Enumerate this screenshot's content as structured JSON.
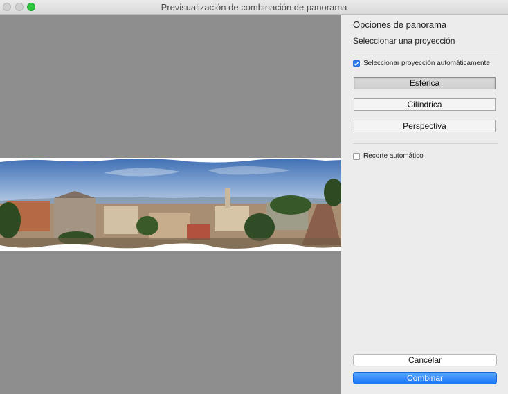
{
  "window": {
    "title": "Previsualización de combinación de panorama"
  },
  "panorama_options": {
    "heading": "Opciones de panorama",
    "subheading": "Seleccionar una proyección",
    "auto_select": {
      "label": "Seleccionar proyección automáticamente",
      "checked": true
    },
    "projections": [
      {
        "label": "Esférica",
        "selected": true
      },
      {
        "label": "Cilíndrica",
        "selected": false
      },
      {
        "label": "Perspectiva",
        "selected": false
      }
    ],
    "auto_crop": {
      "label": "Recorte automático",
      "checked": false
    }
  },
  "actions": {
    "cancel_label": "Cancelar",
    "merge_label": "Combinar"
  },
  "colors": {
    "preview_background": "#8e8e8e",
    "accent": "#2f7ff3",
    "zoom_button": "#2fc73f"
  }
}
